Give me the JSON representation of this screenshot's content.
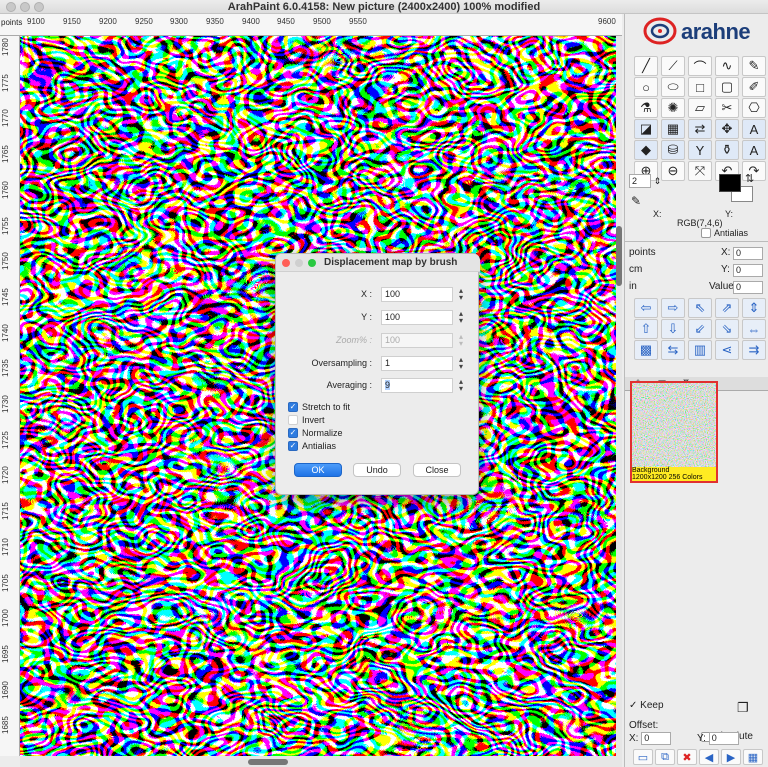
{
  "window": {
    "title": "ArahPaint 6.0.4158: New picture  (2400x2400) 100% modified"
  },
  "ruler": {
    "units": "points",
    "h_ticks": [
      "9100",
      "9150",
      "9200",
      "9250",
      "9300",
      "9350",
      "9400",
      "9450",
      "9500",
      "9550",
      "9600"
    ],
    "v_ticks": [
      "1780",
      "1775",
      "1770",
      "1765",
      "1760",
      "1755",
      "1750",
      "1745",
      "1740",
      "1735",
      "1730",
      "1725",
      "1720",
      "1715",
      "1710",
      "1705",
      "1700",
      "1695",
      "1690",
      "1685"
    ]
  },
  "brand": {
    "name": "arahne"
  },
  "tools": [
    "line-icon",
    "polyline-icon",
    "arc-icon",
    "bezier-icon",
    "pencil-icon",
    "circle-icon",
    "ellipse-icon",
    "rectangle-icon",
    "rectangle-select-icon",
    "brush-icon",
    "eyedropper-icon",
    "spray-icon",
    "eraser-icon",
    "scissors-icon",
    "stamp-icon",
    "fill-icon",
    "pattern-icon",
    "replace-icon",
    "move-icon",
    "text-icon",
    "shape-fill-icon",
    "bucket-icon",
    "y-icon",
    "flask-icon",
    "text-bold-icon",
    "zoom-in-icon",
    "zoom-out-icon",
    "shrink-icon",
    "undo-icon",
    "redo-icon"
  ],
  "props": {
    "brush_size": "2",
    "x_label": "X:",
    "y_label": "Y:",
    "rgb": "RGB(7,4,6)",
    "antialias": "Antialias"
  },
  "units": [
    {
      "unit": "points",
      "field": "X:",
      "value": "0"
    },
    {
      "unit": "cm",
      "field": "Y:",
      "value": "0"
    },
    {
      "unit": "in",
      "field": "Value",
      "value": "0"
    }
  ],
  "nav": [
    "left-arrow-icon",
    "right-arrow-icon",
    "diag-up-left-icon",
    "diag-up-right-icon",
    "vertical-split-icon",
    "up-arrow-icon",
    "down-arrow-icon",
    "diag-down-left-icon",
    "diag-down-right-icon",
    "flip-icon",
    "checker-icon",
    "swap-icon",
    "gradient-icon",
    "share-icon",
    "double-arrow-icon"
  ],
  "layer": {
    "name": "Background",
    "info": "1200x1200 256 Colors"
  },
  "keep": {
    "label": "Keep",
    "checked": true
  },
  "offset": {
    "label": "Offset:",
    "absolute": "Absolute",
    "x_label": "X:",
    "x_value": "0",
    "y_label": "Y:",
    "y_value": "0"
  },
  "bottom_tools": [
    "new-layer-icon",
    "merge-layer-icon",
    "delete-layer-icon",
    "prev-layer-icon",
    "next-layer-icon",
    "grid-layer-icon"
  ],
  "dialog": {
    "title": "Displacement map by brush",
    "fields": [
      {
        "label": "X :",
        "value": "100",
        "disabled": false
      },
      {
        "label": "Y :",
        "value": "100",
        "disabled": false
      },
      {
        "label": "Zoom% :",
        "value": "100",
        "disabled": true
      },
      {
        "label": "Oversampling :",
        "value": "1",
        "disabled": false
      },
      {
        "label": "Averaging :",
        "value": "9",
        "disabled": false
      }
    ],
    "checks": [
      {
        "label": "Stretch to fit",
        "checked": true
      },
      {
        "label": "Invert",
        "checked": false
      },
      {
        "label": "Normalize",
        "checked": true
      },
      {
        "label": "Antialias",
        "checked": true
      }
    ],
    "buttons": {
      "ok": "OK",
      "undo": "Undo",
      "close": "Close"
    }
  },
  "colors": {
    "accent": "#1f73e6",
    "foreground": "#000000",
    "background": "#ffffff",
    "layer_frame": "#e13030",
    "layer_label_bg": "#ffeb22"
  }
}
